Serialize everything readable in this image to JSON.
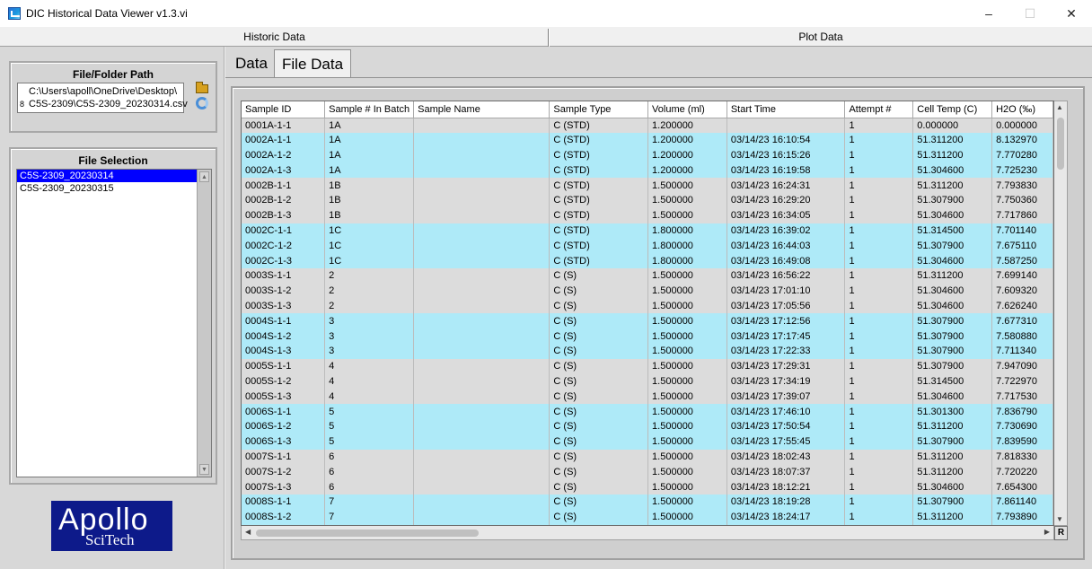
{
  "window": {
    "title": "DIC Historical Data Viewer v1.3.vi",
    "minimize": "–",
    "maximize": "☐",
    "close": "✕"
  },
  "top_tabs": [
    "Historic Data",
    "Plot Data"
  ],
  "file_path": {
    "title": "File/Folder Path",
    "line1": "C:\\Users\\apoll\\OneDrive\\Desktop\\",
    "line2": "C5S-2309\\C5S-2309_20230314.csv",
    "marker": "8"
  },
  "file_selection": {
    "title": "File Selection",
    "items": [
      "C5S-2309_20230314",
      "C5S-2309_20230315"
    ],
    "selected_index": 0
  },
  "logo": {
    "main": "Apollo",
    "sub": "SciTech"
  },
  "sub_tabs": [
    "Data",
    "File Data"
  ],
  "active_sub_tab": "File Data",
  "table": {
    "columns": [
      "Sample ID",
      "Sample # In Batch",
      "Sample Name",
      "Sample Type",
      "Volume (ml)",
      "Start Time",
      "Attempt #",
      "Cell Temp (C)",
      "H2O (‰)"
    ],
    "rows": [
      [
        "0001A-1-1",
        "1A",
        "",
        "C (STD)",
        "1.200000",
        "",
        "1",
        "0.000000",
        "0.000000"
      ],
      [
        "0002A-1-1",
        "1A",
        "",
        "C (STD)",
        "1.200000",
        "03/14/23  16:10:54",
        "1",
        "51.311200",
        "8.132970"
      ],
      [
        "0002A-1-2",
        "1A",
        "",
        "C (STD)",
        "1.200000",
        "03/14/23  16:15:26",
        "1",
        "51.311200",
        "7.770280"
      ],
      [
        "0002A-1-3",
        "1A",
        "",
        "C (STD)",
        "1.200000",
        "03/14/23  16:19:58",
        "1",
        "51.304600",
        "7.725230"
      ],
      [
        "0002B-1-1",
        "1B",
        "",
        "C (STD)",
        "1.500000",
        "03/14/23  16:24:31",
        "1",
        "51.311200",
        "7.793830"
      ],
      [
        "0002B-1-2",
        "1B",
        "",
        "C (STD)",
        "1.500000",
        "03/14/23  16:29:20",
        "1",
        "51.307900",
        "7.750360"
      ],
      [
        "0002B-1-3",
        "1B",
        "",
        "C (STD)",
        "1.500000",
        "03/14/23  16:34:05",
        "1",
        "51.304600",
        "7.717860"
      ],
      [
        "0002C-1-1",
        "1C",
        "",
        "C (STD)",
        "1.800000",
        "03/14/23  16:39:02",
        "1",
        "51.314500",
        "7.701140"
      ],
      [
        "0002C-1-2",
        "1C",
        "",
        "C (STD)",
        "1.800000",
        "03/14/23  16:44:03",
        "1",
        "51.307900",
        "7.675110"
      ],
      [
        "0002C-1-3",
        "1C",
        "",
        "C (STD)",
        "1.800000",
        "03/14/23  16:49:08",
        "1",
        "51.304600",
        "7.587250"
      ],
      [
        "0003S-1-1",
        "2",
        "",
        "C (S)",
        "1.500000",
        "03/14/23  16:56:22",
        "1",
        "51.311200",
        "7.699140"
      ],
      [
        "0003S-1-2",
        "2",
        "",
        "C (S)",
        "1.500000",
        "03/14/23  17:01:10",
        "1",
        "51.304600",
        "7.609320"
      ],
      [
        "0003S-1-3",
        "2",
        "",
        "C (S)",
        "1.500000",
        "03/14/23  17:05:56",
        "1",
        "51.304600",
        "7.626240"
      ],
      [
        "0004S-1-1",
        "3",
        "",
        "C (S)",
        "1.500000",
        "03/14/23  17:12:56",
        "1",
        "51.307900",
        "7.677310"
      ],
      [
        "0004S-1-2",
        "3",
        "",
        "C (S)",
        "1.500000",
        "03/14/23  17:17:45",
        "1",
        "51.307900",
        "7.580880"
      ],
      [
        "0004S-1-3",
        "3",
        "",
        "C (S)",
        "1.500000",
        "03/14/23  17:22:33",
        "1",
        "51.307900",
        "7.711340"
      ],
      [
        "0005S-1-1",
        "4",
        "",
        "C (S)",
        "1.500000",
        "03/14/23  17:29:31",
        "1",
        "51.307900",
        "7.947090"
      ],
      [
        "0005S-1-2",
        "4",
        "",
        "C (S)",
        "1.500000",
        "03/14/23  17:34:19",
        "1",
        "51.314500",
        "7.722970"
      ],
      [
        "0005S-1-3",
        "4",
        "",
        "C (S)",
        "1.500000",
        "03/14/23  17:39:07",
        "1",
        "51.304600",
        "7.717530"
      ],
      [
        "0006S-1-1",
        "5",
        "",
        "C (S)",
        "1.500000",
        "03/14/23  17:46:10",
        "1",
        "51.301300",
        "7.836790"
      ],
      [
        "0006S-1-2",
        "5",
        "",
        "C (S)",
        "1.500000",
        "03/14/23  17:50:54",
        "1",
        "51.311200",
        "7.730690"
      ],
      [
        "0006S-1-3",
        "5",
        "",
        "C (S)",
        "1.500000",
        "03/14/23  17:55:45",
        "1",
        "51.307900",
        "7.839590"
      ],
      [
        "0007S-1-1",
        "6",
        "",
        "C (S)",
        "1.500000",
        "03/14/23  18:02:43",
        "1",
        "51.311200",
        "7.818330"
      ],
      [
        "0007S-1-2",
        "6",
        "",
        "C (S)",
        "1.500000",
        "03/14/23  18:07:37",
        "1",
        "51.311200",
        "7.720220"
      ],
      [
        "0007S-1-3",
        "6",
        "",
        "C (S)",
        "1.500000",
        "03/14/23  18:12:21",
        "1",
        "51.304600",
        "7.654300"
      ],
      [
        "0008S-1-1",
        "7",
        "",
        "C (S)",
        "1.500000",
        "03/14/23  18:19:28",
        "1",
        "51.307900",
        "7.861140"
      ],
      [
        "0008S-1-2",
        "7",
        "",
        "C (S)",
        "1.500000",
        "03/14/23  18:24:17",
        "1",
        "51.311200",
        "7.793890"
      ]
    ],
    "row_colors": [
      "gray",
      "cyan",
      "cyan",
      "cyan",
      "gray",
      "gray",
      "gray",
      "cyan",
      "cyan",
      "cyan",
      "gray",
      "gray",
      "gray",
      "cyan",
      "cyan",
      "cyan",
      "gray",
      "gray",
      "gray",
      "cyan",
      "cyan",
      "cyan",
      "gray",
      "gray",
      "gray",
      "cyan",
      "cyan"
    ],
    "r_button": "R"
  },
  "colors": {
    "row_gray": "#dcdcdc",
    "row_cyan": "#aeeaf8",
    "selection": "#0000ff",
    "logo_bg": "#0d1a8a"
  }
}
